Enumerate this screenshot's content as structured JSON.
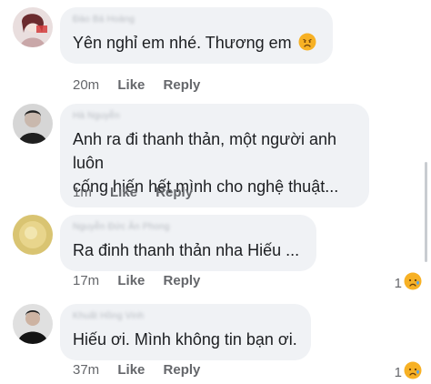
{
  "comments": [
    {
      "author": "Đào Bá Hoàng",
      "text": "Yên nghỉ em nhé. Thương em",
      "time": "20m",
      "like": "Like",
      "reply": "Reply",
      "emoji": "sad-face-icon",
      "reaction_count": ""
    },
    {
      "author": "Hà Nguyễn",
      "text": "Anh ra đi thanh thản, một người anh luôn\ncống hiến hết mình cho nghệ thuật...",
      "time": "1m",
      "like": "Like",
      "reply": "Reply",
      "reaction_count": ""
    },
    {
      "author": "Nguyễn Đức Ân Phong",
      "text": "Ra đinh thanh thản nha Hiếu ...",
      "time": "17m",
      "like": "Like",
      "reply": "Reply",
      "reaction_count": "1"
    },
    {
      "author": "Khuất Hồng Vinh",
      "text": "Hiếu ơi. Mình không tin bạn ơi.",
      "time": "37m",
      "like": "Like",
      "reply": "Reply",
      "reaction_count": "1"
    }
  ],
  "colors": {
    "bubble": "#f0f2f5",
    "text": "#1c1e21",
    "meta": "#65676b",
    "emoji": "#f7b125"
  }
}
